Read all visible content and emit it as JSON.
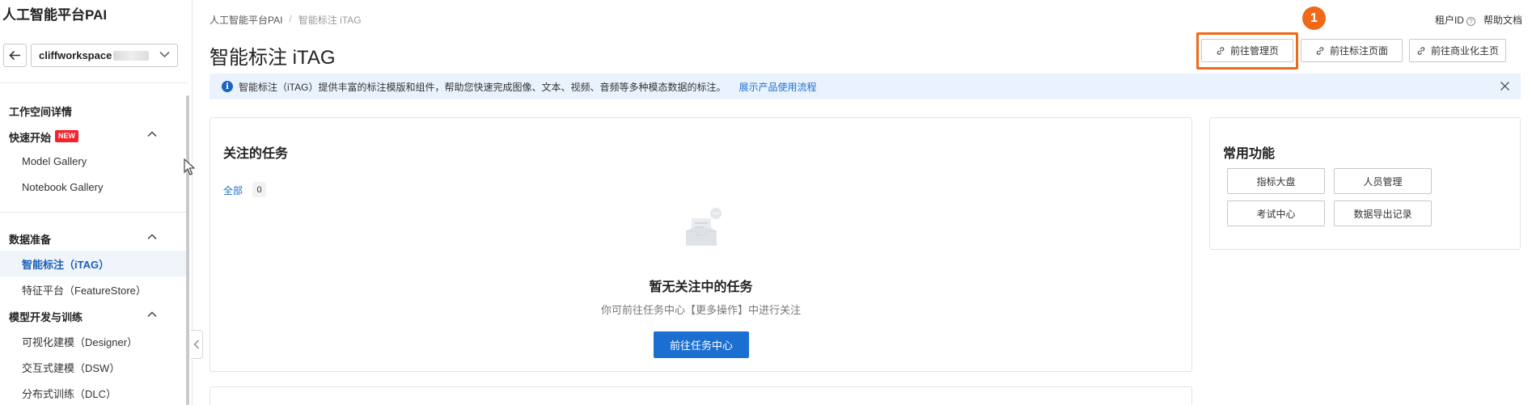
{
  "sidebar": {
    "brand": "人工智能平台PAI",
    "workspace": {
      "name": "cliffworkspace"
    },
    "sections": [
      {
        "title": "工作空间详情"
      },
      {
        "title": "快速开始",
        "badge": "NEW",
        "items": [
          "Model Gallery",
          "Notebook Gallery"
        ]
      },
      {
        "title": "数据准备",
        "items": [
          "智能标注（iTAG）",
          "特征平台（FeatureStore）"
        ]
      },
      {
        "title": "模型开发与训练",
        "items": [
          "可视化建模（Designer）",
          "交互式建模（DSW）",
          "分布式训练（DLC）"
        ]
      }
    ],
    "active_item": "智能标注（iTAG）"
  },
  "header": {
    "breadcrumb": [
      "人工智能平台PAI",
      "智能标注 iTAG"
    ],
    "title": "智能标注 iTAG",
    "top_links": {
      "tenant_id": "租户ID",
      "help_doc": "帮助文档"
    },
    "buttons": [
      "前往管理页",
      "前往标注页面",
      "前往商业化主页"
    ],
    "step_badge": "1"
  },
  "alert": {
    "text": "智能标注（iTAG）提供丰富的标注模版和组件，帮助您快速完成图像、文本、视频、音频等多种模态数据的标注。",
    "link": "展示产品使用流程"
  },
  "followed_tasks": {
    "title": "关注的任务",
    "tab_label": "全部",
    "tab_count": "0",
    "empty_title": "暂无关注中的任务",
    "empty_desc": "你可前往任务中心【更多操作】中进行关注",
    "action_button": "前往任务中心"
  },
  "common_functions": {
    "title": "常用功能",
    "buttons": [
      "指标大盘",
      "人员管理",
      "考试中心",
      "数据导出记录"
    ]
  },
  "colors": {
    "primary": "#1b6fd0",
    "highlight": "#ee6a19",
    "alert_bg": "#eaf3fd",
    "new_badge": "#f5222d"
  }
}
